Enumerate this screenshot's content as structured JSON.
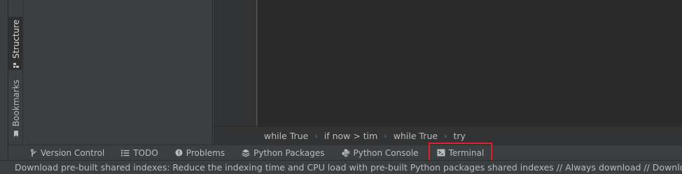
{
  "side_tabs": {
    "structure": "Structure",
    "bookmarks": "Bookmarks"
  },
  "breadcrumb": {
    "items": [
      "while True",
      "if now > tim",
      "while True",
      "try"
    ],
    "separator": "›"
  },
  "tool_windows": {
    "version_control": "Version Control",
    "todo": "TODO",
    "problems": "Problems",
    "python_packages": "Python Packages",
    "python_console": "Python Console",
    "terminal": "Terminal"
  },
  "status_bar": {
    "message": "Download pre-built shared indexes: Reduce the indexing time and CPU load with pre-built Python packages shared indexes // Always download // Download once"
  },
  "colors": {
    "highlight_box": "#e0202a",
    "editor_bg": "#2b2b2b",
    "panel_bg": "#3c3f41"
  }
}
